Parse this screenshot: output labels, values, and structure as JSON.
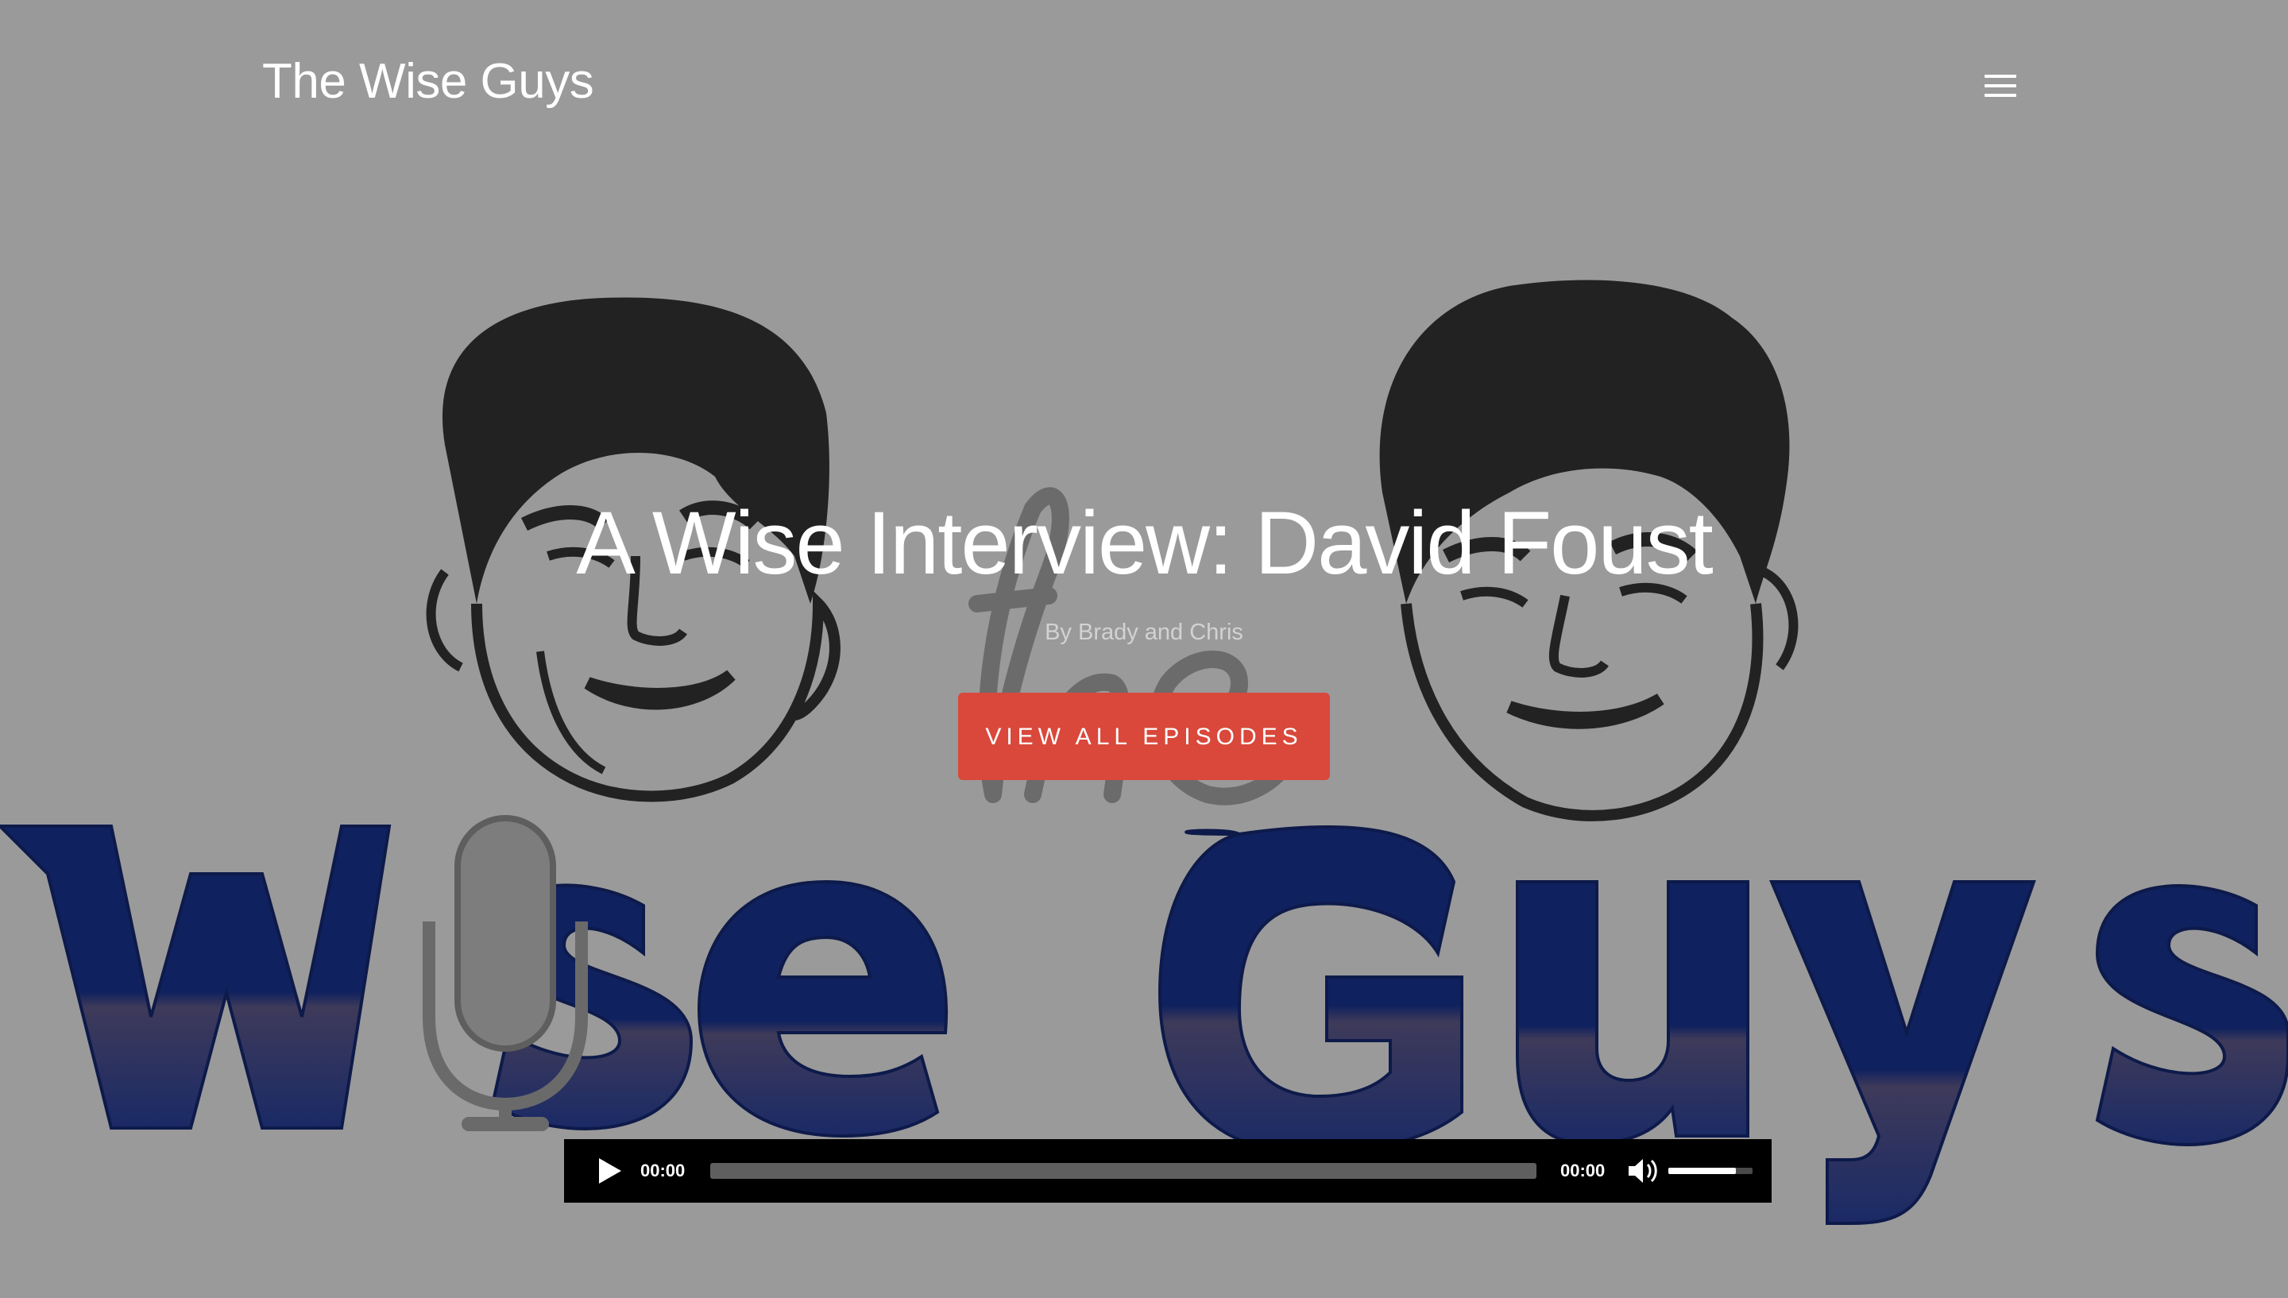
{
  "site": {
    "title": "The Wise Guys"
  },
  "header": {
    "menu_icon": "hamburger-menu-icon"
  },
  "hero": {
    "title": "A Wise Interview: David Foust",
    "byline": "By Brady and Chris",
    "cta_label": "VIEW ALL EPISODES",
    "artwork_wordmark": "the Wise Guys"
  },
  "player": {
    "current_time": "00:00",
    "duration": "00:00",
    "progress": 0,
    "volume": 0.8,
    "icons": {
      "play": "play-icon",
      "mute": "speaker-icon"
    }
  },
  "colors": {
    "background": "#9a9a9a",
    "accent": "#d9483b",
    "wordmark_blue": "#0f2060",
    "player_bg": "#000000"
  }
}
